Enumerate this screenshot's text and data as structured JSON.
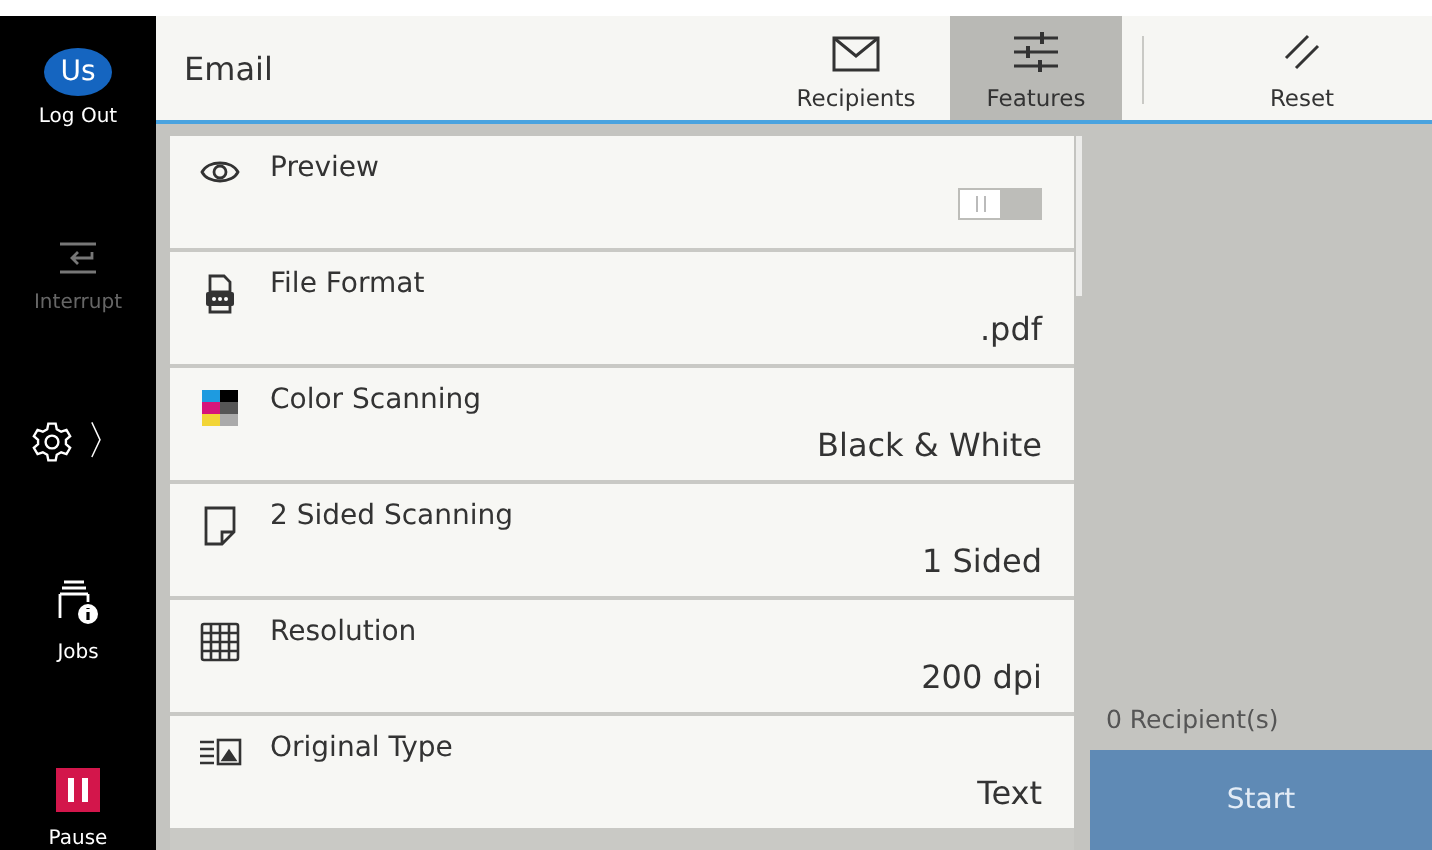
{
  "sidebar": {
    "avatar": {
      "initials": "Us",
      "label": "Log Out"
    },
    "items": [
      {
        "kind": "interrupt",
        "label": "Interrupt",
        "disabled": true
      },
      {
        "kind": "settings",
        "label": "〉",
        "disabled": false
      },
      {
        "kind": "jobs",
        "label": "Jobs",
        "disabled": false
      },
      {
        "kind": "pause",
        "label": "Pause",
        "disabled": false
      }
    ]
  },
  "header": {
    "title": "Email",
    "tabs": [
      {
        "kind": "recipients",
        "label": "Recipients",
        "selected": false
      },
      {
        "kind": "features",
        "label": "Features",
        "selected": true
      }
    ],
    "reset": {
      "label": "Reset"
    }
  },
  "features": [
    {
      "kind": "toggle",
      "label": "Preview",
      "on": false
    },
    {
      "kind": "value",
      "label": "File Format",
      "value": ".pdf"
    },
    {
      "kind": "value",
      "label": "Color Scanning",
      "value": "Black & White"
    },
    {
      "kind": "value",
      "label": "2 Sided Scanning",
      "value": "1 Sided"
    },
    {
      "kind": "value",
      "label": "Resolution",
      "value": "200 dpi"
    },
    {
      "kind": "value",
      "label": "Original Type",
      "value": "Text"
    }
  ],
  "summary": {
    "recipients": "0 Recipient(s)",
    "start": {
      "label": "Start",
      "disabled": true
    }
  }
}
